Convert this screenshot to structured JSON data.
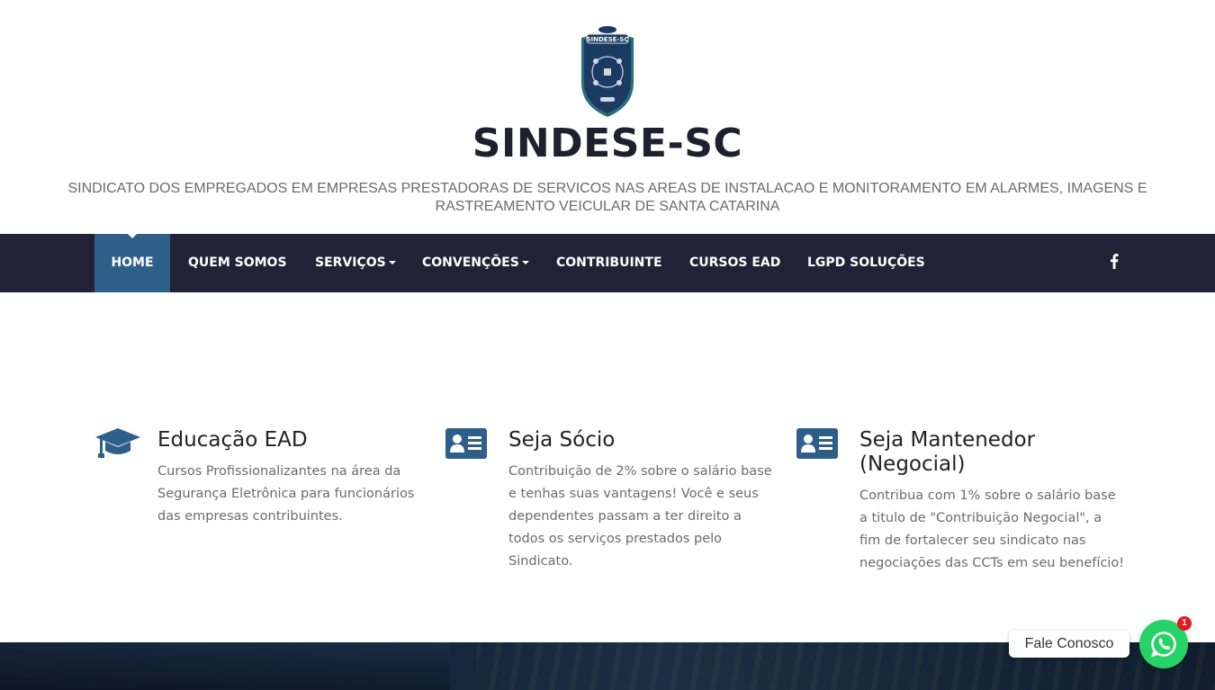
{
  "header": {
    "site_title": "SINDESE-SC",
    "logo_text": "SINDESE-SC",
    "tagline": "SINDICATO DOS EMPREGADOS EM EMPRESAS PRESTADORAS DE SERVICOS NAS AREAS DE INSTALACAO E MONITORAMENTO EM ALARMES, IMAGENS E RASTREAMENTO VEICULAR DE SANTA CATARINA"
  },
  "nav": {
    "items": [
      {
        "label": "HOME",
        "active": true
      },
      {
        "label": "QUEM SOMOS"
      },
      {
        "label": "SERVIÇOS",
        "dropdown": true
      },
      {
        "label": "CONVENÇÕES",
        "dropdown": true
      },
      {
        "label": "CONTRIBUINTE"
      },
      {
        "label": "CURSOS EAD"
      },
      {
        "label": "LGPD SOLUÇÕES"
      }
    ],
    "social_icon": "facebook-icon",
    "colors": {
      "bar": "#222236",
      "active": "#2e5f8a"
    }
  },
  "features": [
    {
      "icon": "graduation-cap-icon",
      "title": "Educação EAD",
      "text_lines": [
        "Cursos Profissionalizantes na área da",
        "Segurança Eletrônica para funcionários",
        "das empresas contribuintes."
      ]
    },
    {
      "icon": "id-card-icon",
      "title": "Seja Sócio",
      "text_lines": [
        "Contribuição de 2% sobre o salário base",
        "e tenhas suas vantagens! Você e seus",
        "dependentes passam a ter direito a",
        "todos os serviços prestados pelo",
        "Sindicato."
      ]
    },
    {
      "icon": "id-card-icon",
      "title_lines": [
        "Seja Mantenedor",
        "(Negocial)"
      ],
      "text_lines": [
        "Contribua com 1% sobre o salário base",
        "a titulo de \"Contribuição Negocial\", a",
        "fim de fortalecer seu sindicato nas",
        "negociações das CCTs em seu benefício!"
      ]
    }
  ],
  "chat": {
    "label": "Fale Conosco",
    "badge_count": "1",
    "icon": "whatsapp-icon",
    "color": "#25d366"
  },
  "accent_color": "#2e5f8a"
}
